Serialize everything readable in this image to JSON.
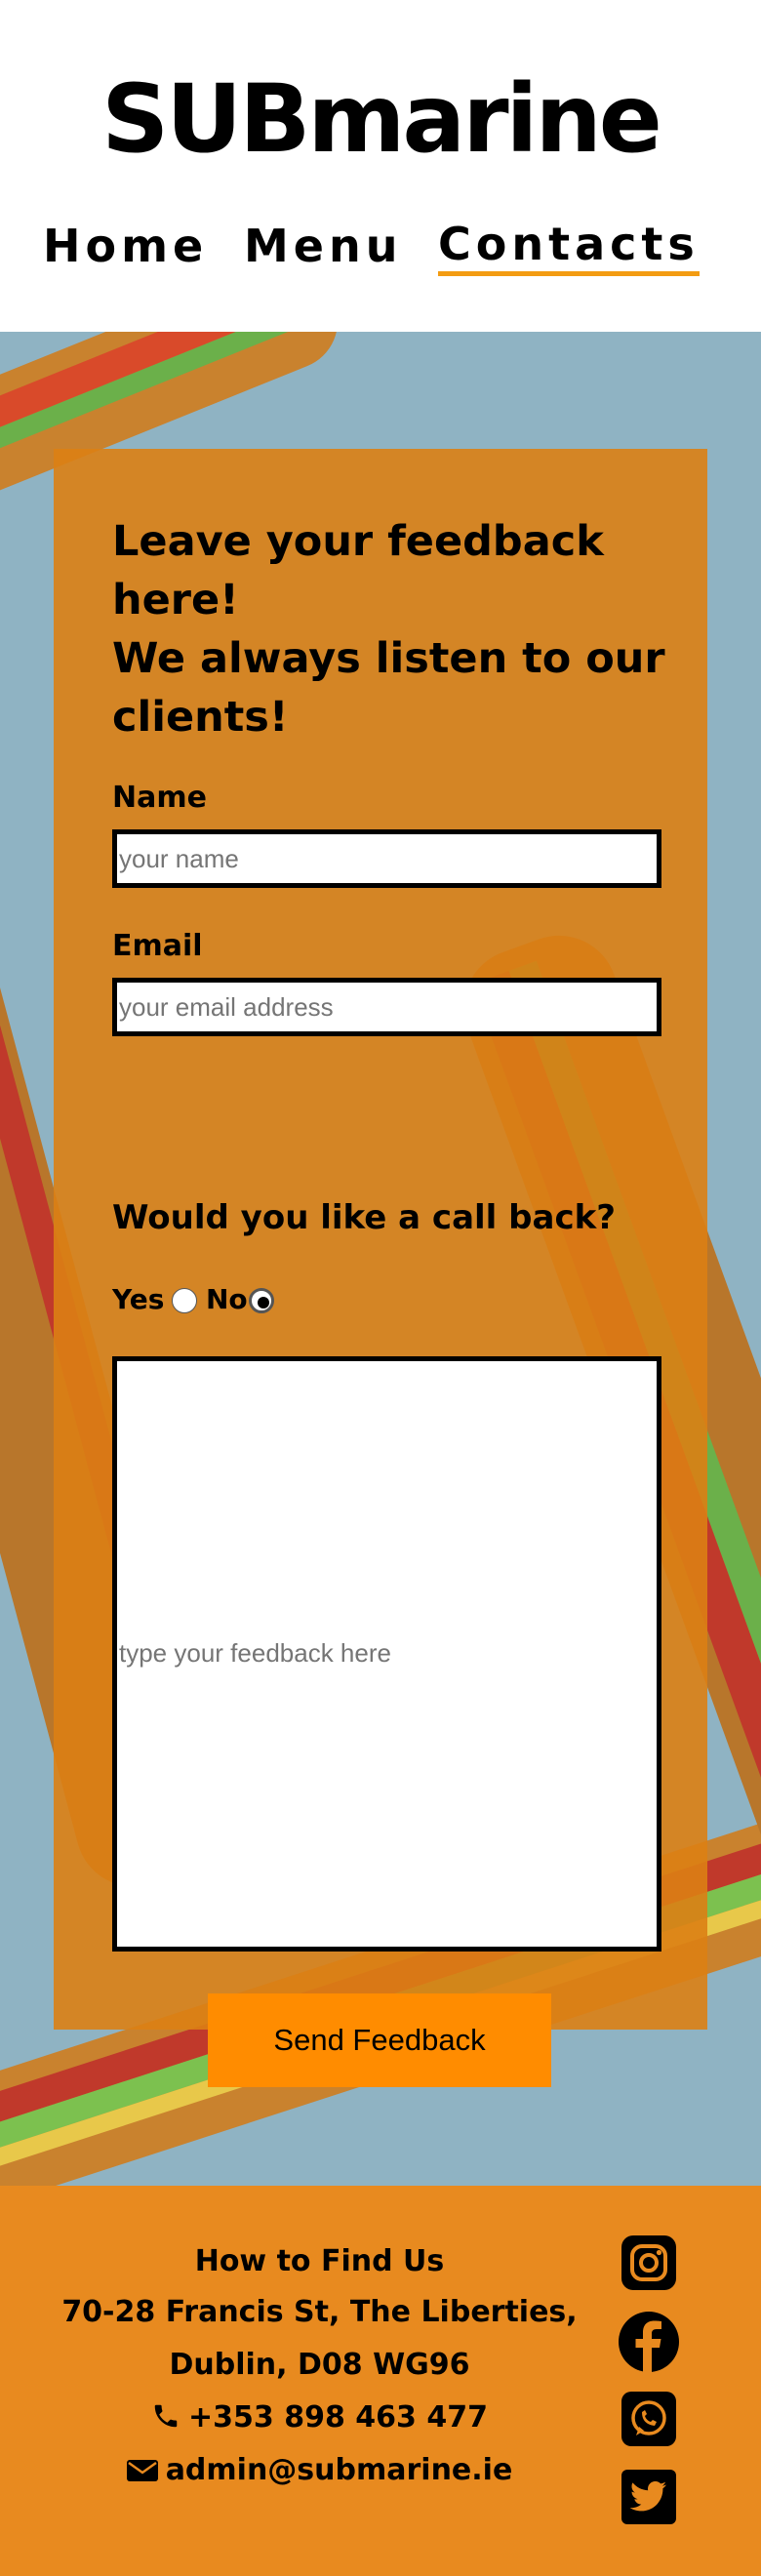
{
  "header": {
    "logo": "SUBmarine",
    "nav": [
      {
        "label": "Home"
      },
      {
        "label": "Menu"
      },
      {
        "label": "Contacts",
        "active": true
      }
    ]
  },
  "form": {
    "heading_line1": "Leave your feedback here!",
    "heading_line2": "We always listen to our clients!",
    "name_label": "Name",
    "name_placeholder": "your name",
    "email_label": "Email",
    "email_placeholder": "your email address",
    "callback_question": "Would you like a call back?",
    "callback_options": [
      {
        "label": "Yes",
        "selected": false
      },
      {
        "label": "No",
        "selected": true
      }
    ],
    "feedback_placeholder": "type your feedback here",
    "submit_label": "Send Feedback"
  },
  "footer": {
    "title": "How to Find Us",
    "address_line1": "70-28 Francis St, The Liberties,",
    "address_line2": "Dublin, D08 WG96",
    "phone": "+353 898 463 477",
    "email": "admin@submarine.ie",
    "social": [
      "instagram-icon",
      "facebook-icon",
      "whatsapp-icon",
      "twitter-icon"
    ]
  },
  "colors": {
    "accent": "#f39c12",
    "card": "#dc8014",
    "footer": "#e88a1f",
    "button": "#ff8c00"
  }
}
